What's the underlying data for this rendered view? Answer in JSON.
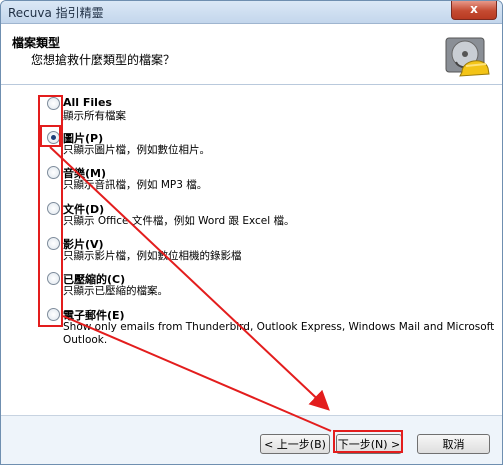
{
  "window": {
    "title": "Recuva 指引精靈",
    "close_label": "x"
  },
  "header": {
    "title": "檔案類型",
    "subtitle": "您想搶救什麼類型的檔案？",
    "icon": "hard-drive-helmet-icon"
  },
  "options": [
    {
      "label": "All Files",
      "description": "顯示所有檔案",
      "checked": false
    },
    {
      "label": "圖片(P)",
      "description": "只顯示圖片檔，例如數位相片。",
      "checked": true
    },
    {
      "label": "音樂(M)",
      "description": "只顯示音訊檔，例如 MP3 檔。",
      "checked": false
    },
    {
      "label": "文件(D)",
      "description": "只顯示 Office 文件檔，例如 Word 跟 Excel 檔。",
      "checked": false
    },
    {
      "label": "影片(V)",
      "description": "只顯示影片檔，例如數位相機的錄影檔",
      "checked": false
    },
    {
      "label": "已壓縮的(C)",
      "description": "只顯示已壓縮的檔案。",
      "checked": false
    },
    {
      "label": "電子郵件(E)",
      "description": "Show only emails from Thunderbird, Outlook Express, Windows Mail and Microsoft",
      "description2": "Outlook.",
      "checked": false
    }
  ],
  "buttons": {
    "back": "< 上一步(B)",
    "next": "下一步(N) >",
    "cancel": "取消"
  },
  "annotation_color": "#e31d1d"
}
